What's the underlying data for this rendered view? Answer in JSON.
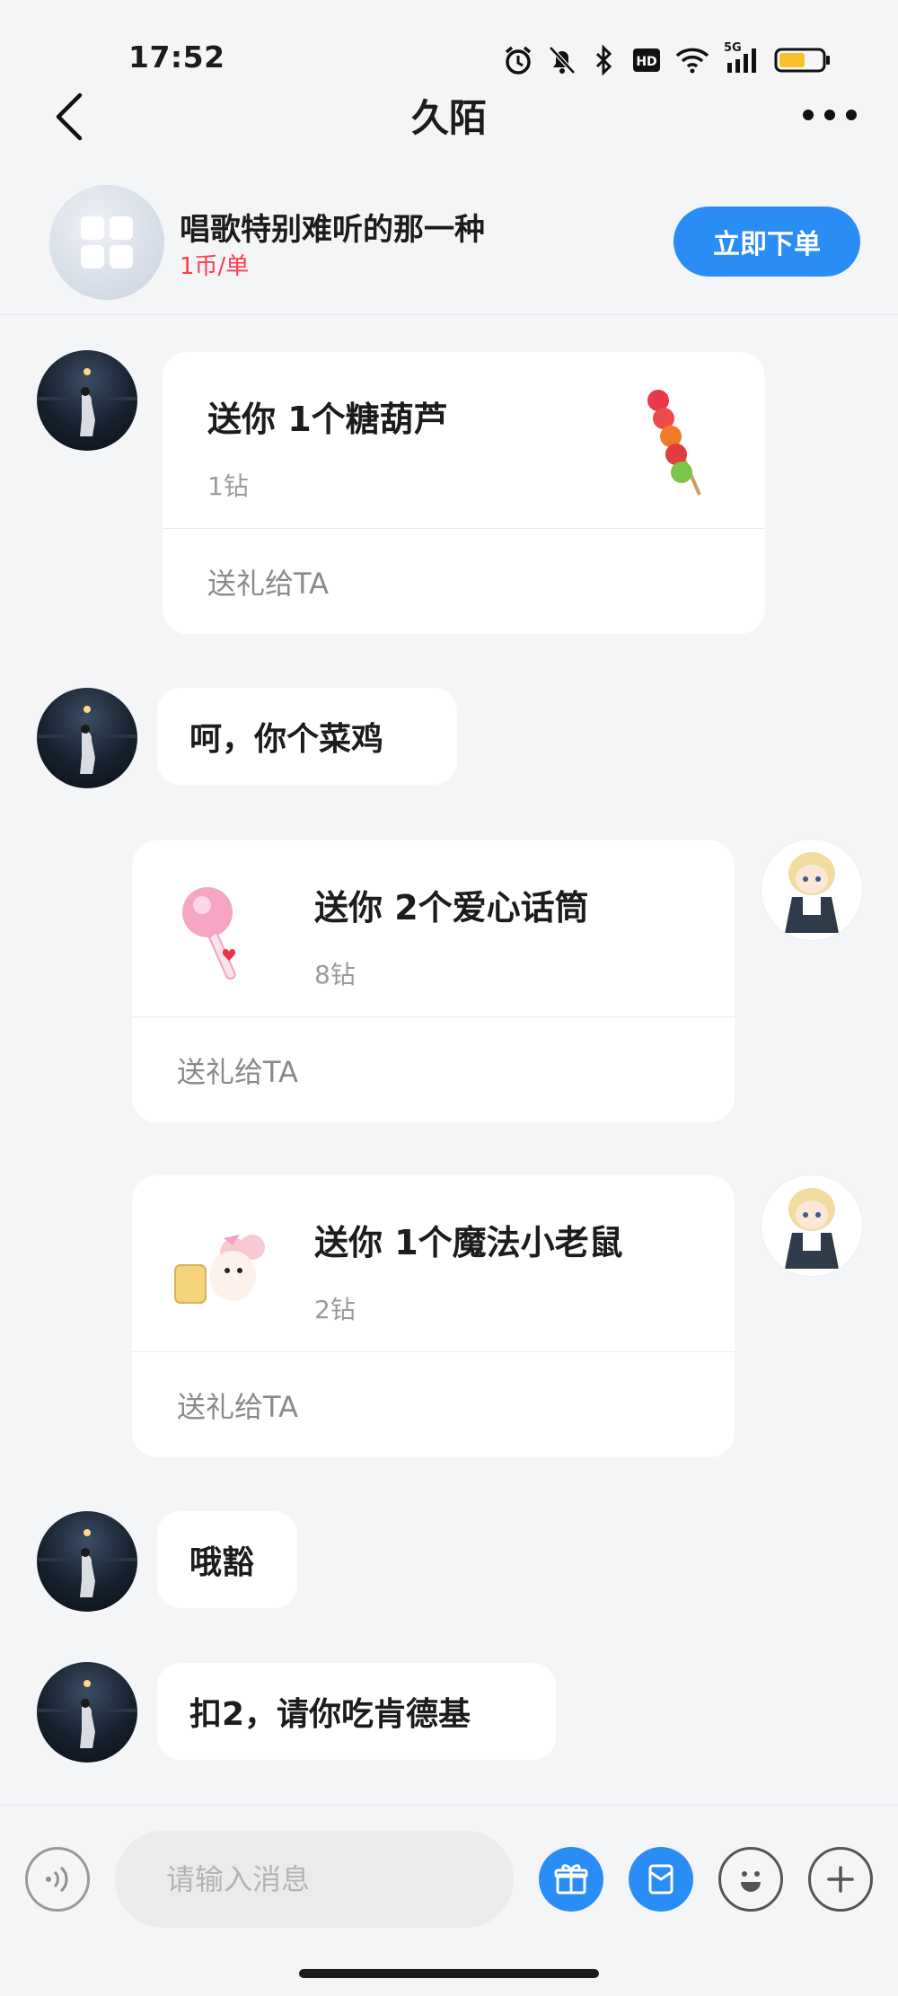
{
  "status_bar": {
    "time": "17:52",
    "network": "5G"
  },
  "header": {
    "title": "久陌"
  },
  "order": {
    "title": "唱歌特别难听的那一种",
    "price": "1币/单",
    "button_label": "立即下单",
    "price_color": "#ff3b4d",
    "button_color": "#2a8df6"
  },
  "messages": [
    {
      "side": "left",
      "type": "gift",
      "title": "送你 1个糖葫芦",
      "price": "1钻",
      "action": "送礼给TA",
      "gift_icon": "candied-haws-icon"
    },
    {
      "side": "left",
      "type": "text",
      "text": "呵，你个菜鸡"
    },
    {
      "side": "right",
      "type": "gift",
      "title": "送你 2个爱心话筒",
      "price": "8钻",
      "action": "送礼给TA",
      "gift_icon": "heart-microphone-icon"
    },
    {
      "side": "right",
      "type": "gift",
      "title": "送你 1个魔法小老鼠",
      "price": "2钻",
      "action": "送礼给TA",
      "gift_icon": "magic-mouse-icon"
    },
    {
      "side": "left",
      "type": "text",
      "text": "哦豁"
    },
    {
      "side": "left",
      "type": "text",
      "text": "扣2，请你吃肯德基"
    }
  ],
  "input": {
    "placeholder": "请输入消息"
  },
  "toolbar_icons": [
    "voice-icon",
    "gift-icon",
    "red-packet-icon",
    "emoji-icon",
    "plus-icon"
  ]
}
